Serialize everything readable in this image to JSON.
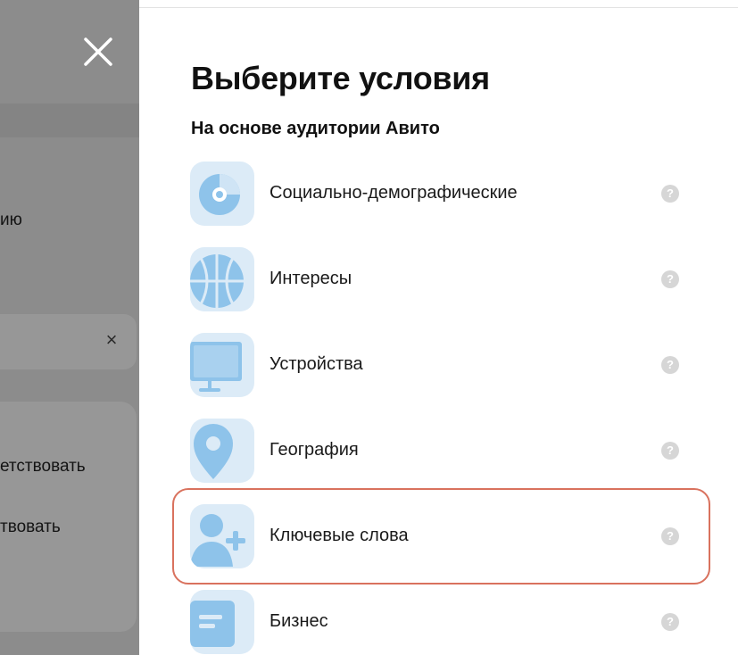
{
  "background": {
    "text_1": "ию",
    "text_2": "етствовать",
    "text_3": "твовать",
    "input_clear_glyph": "×"
  },
  "modal": {
    "title": "Выберите условия",
    "section_title": "На основе аудитории Авито",
    "items": [
      {
        "label": "Социально-демографические",
        "icon": "pie-chart-icon",
        "help": "?"
      },
      {
        "label": "Интересы",
        "icon": "basketball-icon",
        "help": "?"
      },
      {
        "label": "Устройства",
        "icon": "monitor-icon",
        "help": "?"
      },
      {
        "label": "География",
        "icon": "map-pin-icon",
        "help": "?"
      },
      {
        "label": "Ключевые слова",
        "icon": "user-plus-icon",
        "help": "?",
        "highlighted": true
      },
      {
        "label": "Бизнес",
        "icon": "id-card-icon",
        "help": "?"
      }
    ]
  },
  "colors": {
    "icon_bg": "#dcebf7",
    "icon_blue": "#8ec3ea",
    "highlight_border": "#d9725e",
    "overlay": "#8c8c8c"
  }
}
